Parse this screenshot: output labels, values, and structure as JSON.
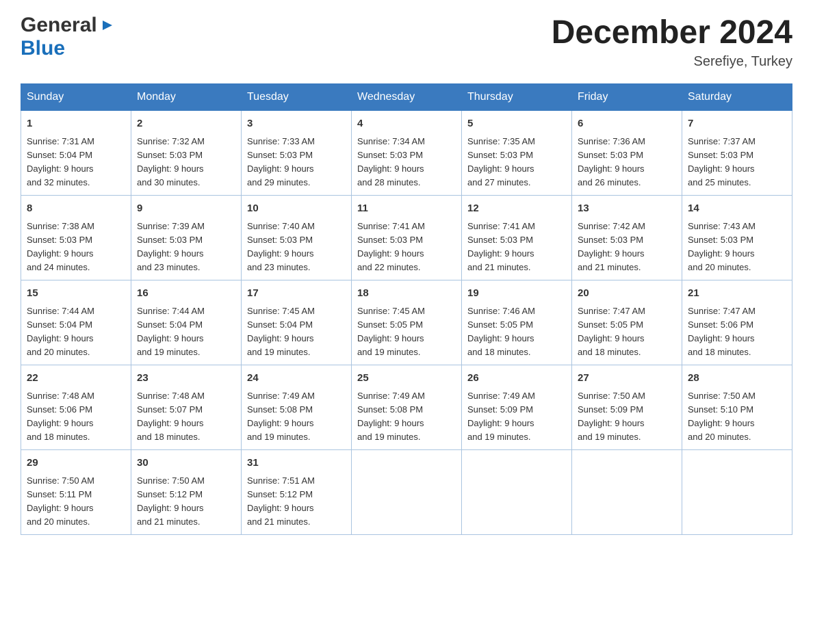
{
  "logo": {
    "general": "General",
    "blue": "Blue",
    "arrow": "▶"
  },
  "title": "December 2024",
  "location": "Serefiye, Turkey",
  "days_of_week": [
    "Sunday",
    "Monday",
    "Tuesday",
    "Wednesday",
    "Thursday",
    "Friday",
    "Saturday"
  ],
  "weeks": [
    [
      {
        "day": "1",
        "sunrise": "7:31 AM",
        "sunset": "5:04 PM",
        "daylight": "9 hours and 32 minutes."
      },
      {
        "day": "2",
        "sunrise": "7:32 AM",
        "sunset": "5:03 PM",
        "daylight": "9 hours and 30 minutes."
      },
      {
        "day": "3",
        "sunrise": "7:33 AM",
        "sunset": "5:03 PM",
        "daylight": "9 hours and 29 minutes."
      },
      {
        "day": "4",
        "sunrise": "7:34 AM",
        "sunset": "5:03 PM",
        "daylight": "9 hours and 28 minutes."
      },
      {
        "day": "5",
        "sunrise": "7:35 AM",
        "sunset": "5:03 PM",
        "daylight": "9 hours and 27 minutes."
      },
      {
        "day": "6",
        "sunrise": "7:36 AM",
        "sunset": "5:03 PM",
        "daylight": "9 hours and 26 minutes."
      },
      {
        "day": "7",
        "sunrise": "7:37 AM",
        "sunset": "5:03 PM",
        "daylight": "9 hours and 25 minutes."
      }
    ],
    [
      {
        "day": "8",
        "sunrise": "7:38 AM",
        "sunset": "5:03 PM",
        "daylight": "9 hours and 24 minutes."
      },
      {
        "day": "9",
        "sunrise": "7:39 AM",
        "sunset": "5:03 PM",
        "daylight": "9 hours and 23 minutes."
      },
      {
        "day": "10",
        "sunrise": "7:40 AM",
        "sunset": "5:03 PM",
        "daylight": "9 hours and 23 minutes."
      },
      {
        "day": "11",
        "sunrise": "7:41 AM",
        "sunset": "5:03 PM",
        "daylight": "9 hours and 22 minutes."
      },
      {
        "day": "12",
        "sunrise": "7:41 AM",
        "sunset": "5:03 PM",
        "daylight": "9 hours and 21 minutes."
      },
      {
        "day": "13",
        "sunrise": "7:42 AM",
        "sunset": "5:03 PM",
        "daylight": "9 hours and 21 minutes."
      },
      {
        "day": "14",
        "sunrise": "7:43 AM",
        "sunset": "5:03 PM",
        "daylight": "9 hours and 20 minutes."
      }
    ],
    [
      {
        "day": "15",
        "sunrise": "7:44 AM",
        "sunset": "5:04 PM",
        "daylight": "9 hours and 20 minutes."
      },
      {
        "day": "16",
        "sunrise": "7:44 AM",
        "sunset": "5:04 PM",
        "daylight": "9 hours and 19 minutes."
      },
      {
        "day": "17",
        "sunrise": "7:45 AM",
        "sunset": "5:04 PM",
        "daylight": "9 hours and 19 minutes."
      },
      {
        "day": "18",
        "sunrise": "7:45 AM",
        "sunset": "5:05 PM",
        "daylight": "9 hours and 19 minutes."
      },
      {
        "day": "19",
        "sunrise": "7:46 AM",
        "sunset": "5:05 PM",
        "daylight": "9 hours and 18 minutes."
      },
      {
        "day": "20",
        "sunrise": "7:47 AM",
        "sunset": "5:05 PM",
        "daylight": "9 hours and 18 minutes."
      },
      {
        "day": "21",
        "sunrise": "7:47 AM",
        "sunset": "5:06 PM",
        "daylight": "9 hours and 18 minutes."
      }
    ],
    [
      {
        "day": "22",
        "sunrise": "7:48 AM",
        "sunset": "5:06 PM",
        "daylight": "9 hours and 18 minutes."
      },
      {
        "day": "23",
        "sunrise": "7:48 AM",
        "sunset": "5:07 PM",
        "daylight": "9 hours and 18 minutes."
      },
      {
        "day": "24",
        "sunrise": "7:49 AM",
        "sunset": "5:08 PM",
        "daylight": "9 hours and 19 minutes."
      },
      {
        "day": "25",
        "sunrise": "7:49 AM",
        "sunset": "5:08 PM",
        "daylight": "9 hours and 19 minutes."
      },
      {
        "day": "26",
        "sunrise": "7:49 AM",
        "sunset": "5:09 PM",
        "daylight": "9 hours and 19 minutes."
      },
      {
        "day": "27",
        "sunrise": "7:50 AM",
        "sunset": "5:09 PM",
        "daylight": "9 hours and 19 minutes."
      },
      {
        "day": "28",
        "sunrise": "7:50 AM",
        "sunset": "5:10 PM",
        "daylight": "9 hours and 20 minutes."
      }
    ],
    [
      {
        "day": "29",
        "sunrise": "7:50 AM",
        "sunset": "5:11 PM",
        "daylight": "9 hours and 20 minutes."
      },
      {
        "day": "30",
        "sunrise": "7:50 AM",
        "sunset": "5:12 PM",
        "daylight": "9 hours and 21 minutes."
      },
      {
        "day": "31",
        "sunrise": "7:51 AM",
        "sunset": "5:12 PM",
        "daylight": "9 hours and 21 minutes."
      },
      null,
      null,
      null,
      null
    ]
  ],
  "labels": {
    "sunrise": "Sunrise:",
    "sunset": "Sunset:",
    "daylight": "Daylight:"
  }
}
